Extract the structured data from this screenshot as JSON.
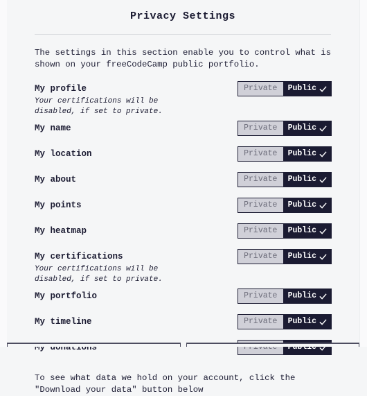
{
  "page": {
    "title": "Privacy Settings",
    "intro": "The settings in this section enable you to control what is shown on your freeCodeCamp public portfolio.",
    "footer_note": "To see what data we hold on your account, click the \"Download your data\" button below"
  },
  "toggle_labels": {
    "private": "Private",
    "public": "Public",
    "check_icon": "check-icon"
  },
  "colors": {
    "page_background": "#f5f6f7",
    "text": "#1b1b32",
    "public_active_background": "#1b1b32",
    "private_inactive_background": "#d0d0d8",
    "private_inactive_text": "#6c6c7a",
    "divider": "#d8dade"
  },
  "settings": [
    {
      "label": "My profile",
      "note": "Your certifications will be disabled, if set to private.",
      "value": "Public"
    },
    {
      "label": "My name",
      "note": "",
      "value": "Public"
    },
    {
      "label": "My location",
      "note": "",
      "value": "Public"
    },
    {
      "label": "My about",
      "note": "",
      "value": "Public"
    },
    {
      "label": "My points",
      "note": "",
      "value": "Public"
    },
    {
      "label": "My heatmap",
      "note": "",
      "value": "Public"
    },
    {
      "label": "My certifications",
      "note": "Your certifications will be disabled, if set to private.",
      "value": "Public"
    },
    {
      "label": "My portfolio",
      "note": "",
      "value": "Public"
    },
    {
      "label": "My timeline",
      "note": "",
      "value": "Public"
    },
    {
      "label": "My donations",
      "note": "",
      "value": "Public"
    }
  ]
}
